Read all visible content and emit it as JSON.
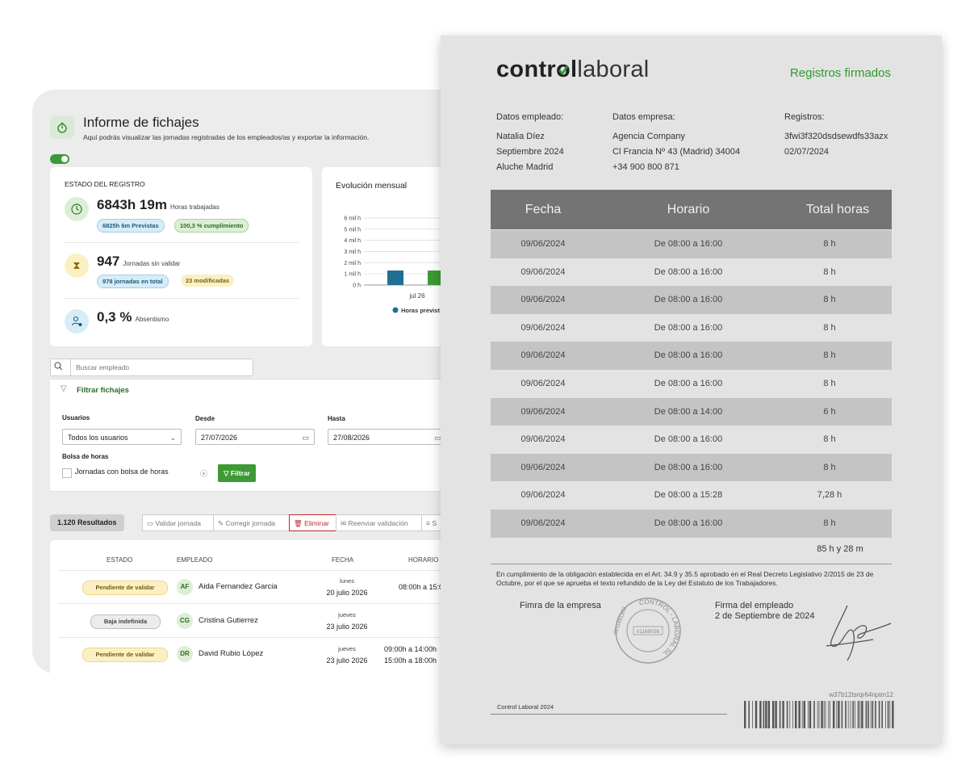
{
  "app": {
    "title": "Informe de fichajes",
    "subtitle": "Aquí podrás visualizar las jornadas registradas de los empleados/as y exportar la información.",
    "status_card": {
      "label": "ESTADO DEL REGISTRO",
      "hours": {
        "value": "6843h 19m",
        "caption": "Horas trabajadas",
        "pill_a": "6825h 6m Previstas",
        "pill_b": "100,3 % cumplimiento"
      },
      "days": {
        "value": "947",
        "caption": "Jornadas sin validar",
        "pill_a": "978 jornadas en total",
        "pill_b": "23 modificadas"
      },
      "absence": {
        "value": "0,3 %",
        "caption": "Absentismo"
      }
    },
    "chart_card": {
      "title": "Evolución mensual",
      "legend_label": "Horas previst"
    },
    "search": {
      "placeholder": "Buscar empleado"
    },
    "filters": {
      "title": "Filtrar fichajes",
      "users_label": "Usuarios",
      "users_value": "Todos los usuarios",
      "from_label": "Desde",
      "from_value": "27/07/2026",
      "to_label": "Hasta",
      "to_value": "27/08/2026",
      "bag_label": "Bolsa de horas",
      "bag_option": "Jornadas con bolsa de horas",
      "filter_button": "Filtrar"
    },
    "toolbar": {
      "results": "1.120 Resultados",
      "validate": "Validar jornada",
      "correct": "Corregir jornada",
      "delete": "Eliminar",
      "resend": "Reenviar validación",
      "more": "S"
    },
    "table": {
      "headers": [
        "ESTADO",
        "EMPLEADO",
        "FECHA",
        "HORARIO"
      ],
      "rows": [
        {
          "status": "Pendiente de validar",
          "initials": "AF",
          "name": "Aida Fernandez Garcia",
          "day": "lunes",
          "date": "20 julio 2026",
          "hours1": "08:00h a 15:0",
          "hours2": ""
        },
        {
          "status": "Baja indefinida",
          "initials": "CG",
          "name": "Cristina Gutierrez",
          "day": "jueves",
          "date": "23 julio 2026",
          "hours1": "",
          "hours2": ""
        },
        {
          "status": "Pendiente de validar",
          "initials": "DR",
          "name": "David Rubio López",
          "day": "jueves",
          "date": "23 julio 2026",
          "hours1": "09:00h a 14:00h",
          "hours2": "15:00h a 18:00h"
        }
      ]
    }
  },
  "chart_data": {
    "type": "bar",
    "title": "Evolución mensual",
    "categories": [
      "jul 26"
    ],
    "series": [
      {
        "name": "Horas previst",
        "values": [
          1300
        ],
        "color": "#1f6f93"
      },
      {
        "values": [
          1300
        ],
        "color": "#3d9a35"
      }
    ],
    "yticks": [
      "0 h",
      "1 mil h",
      "2 mil h",
      "3 mil h",
      "4 mil h",
      "5 mil h",
      "6 mil h"
    ],
    "ylim": [
      0,
      6000
    ],
    "grid": true,
    "legend_position": "bottom"
  },
  "document": {
    "logo_prefix": "contr",
    "logo_o": "o",
    "logo_mid": "l",
    "logo_suffix": "laboral",
    "badge": "Registros firmados",
    "employee_header": "Datos empleado:",
    "employee_lines": [
      "Natalia Díez",
      "Septiembre 2024",
      "Aluche Madrid"
    ],
    "company_header": "Datos empresa:",
    "company_lines": [
      "Agencia Company",
      "Cl Francia Nº 43 (Madrid) 34004",
      "+34 900 800 871"
    ],
    "records_header": "Registros:",
    "records_lines": [
      "3fwi3f320dsdsewdfs33azx",
      "02/07/2024"
    ],
    "table_headers": [
      "Fecha",
      "Horario",
      "Total horas"
    ],
    "rows": [
      {
        "date": "09/06/2024",
        "schedule": "De 08:00 a 16:00",
        "total": "8 h"
      },
      {
        "date": "09/06/2024",
        "schedule": "De 08:00 a 16:00",
        "total": "8 h"
      },
      {
        "date": "09/06/2024",
        "schedule": "De 08:00 a 16:00",
        "total": "8 h"
      },
      {
        "date": "09/06/2024",
        "schedule": "De 08:00 a 16:00",
        "total": "8 h"
      },
      {
        "date": "09/06/2024",
        "schedule": "De 08:00 a 16:00",
        "total": "8 h"
      },
      {
        "date": "09/06/2024",
        "schedule": "De 08:00 a 16:00",
        "total": "8 h"
      },
      {
        "date": "09/06/2024",
        "schedule": "De 08:00 a 14:00",
        "total": "6 h"
      },
      {
        "date": "09/06/2024",
        "schedule": "De 08:00 a 16:00",
        "total": "8 h"
      },
      {
        "date": "09/06/2024",
        "schedule": "De 08:00 a 16:00",
        "total": "8 h"
      },
      {
        "date": "09/06/2024",
        "schedule": "De 08:00 a 15:28",
        "total": "7,28 h"
      },
      {
        "date": "09/06/2024",
        "schedule": "De 08:00 a 16:00",
        "total": "8 h"
      }
    ],
    "grand_total": "85 h y 28 m",
    "legal_text": "En cumplimiento de la obligación establecida en el Art. 34.9 y 35.5 aprobado en el Real Decreto Legislativo 2/2015 de 23 de Octubre, por el que se aprueba el texto refundido de la Ley del Estatuto de los Trabajadores.",
    "company_signature_label": "Fimra de la empresa",
    "employee_signature_label": "Firma del empleado",
    "employee_signature_date": "2 de Septiembre de 2024",
    "stamp_text": "CONTROL - LABORAL SL",
    "stamp_code": "01169036 ",
    "stamp_number": "0211691362",
    "footer": "Control Laboral 2024",
    "barcode_id": "w37b12tsrqr64nptm12"
  },
  "colors": {
    "accent_green": "#3d9a35",
    "chart_blue": "#1f6f93",
    "delete_red": "#c0262d",
    "doc_badge_green": "#2e9a2e"
  },
  "icons": [
    "stopwatch-icon",
    "clock-icon",
    "hourglass-icon",
    "user-absence-icon",
    "search-icon",
    "funnel-icon",
    "calendar-icon",
    "chevron-down-icon",
    "clear-icon",
    "trash-icon",
    "edit-icon",
    "checkmark-icon",
    "barcode-icon",
    "stamp-seal"
  ]
}
